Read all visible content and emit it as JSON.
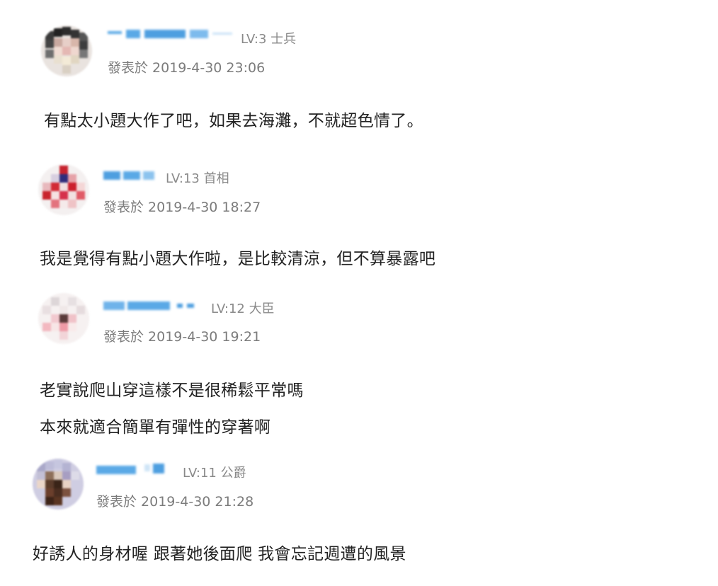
{
  "comments": [
    {
      "level": "LV:3 士兵",
      "posted": "發表於 2019-4-30 23:06",
      "lines": [
        "有點太小題大作了吧，如果去海灘，不就超色情了。"
      ]
    },
    {
      "level": "LV:13 首相",
      "posted": "發表於 2019-4-30 18:27",
      "lines": [
        "我是覺得有點小題大作啦，是比較清涼，但不算暴露吧"
      ]
    },
    {
      "level": "LV:12 大臣",
      "posted": "發表於 2019-4-30 19:21",
      "lines": [
        "老實說爬山穿這樣不是很稀鬆平常嗎",
        "本來就適合簡單有彈性的穿著啊"
      ]
    },
    {
      "level": "LV:11 公爵",
      "posted": "發表於 2019-4-30 21:28",
      "lines": [
        "好誘人的身材喔 跟著她後面爬 我會忘記週遭的風景"
      ]
    }
  ],
  "colors": {
    "username_blue": "#5aa9e6",
    "meta_gray": "#8a8a8a",
    "text": "#222222"
  },
  "icons": [
    "avatar"
  ]
}
